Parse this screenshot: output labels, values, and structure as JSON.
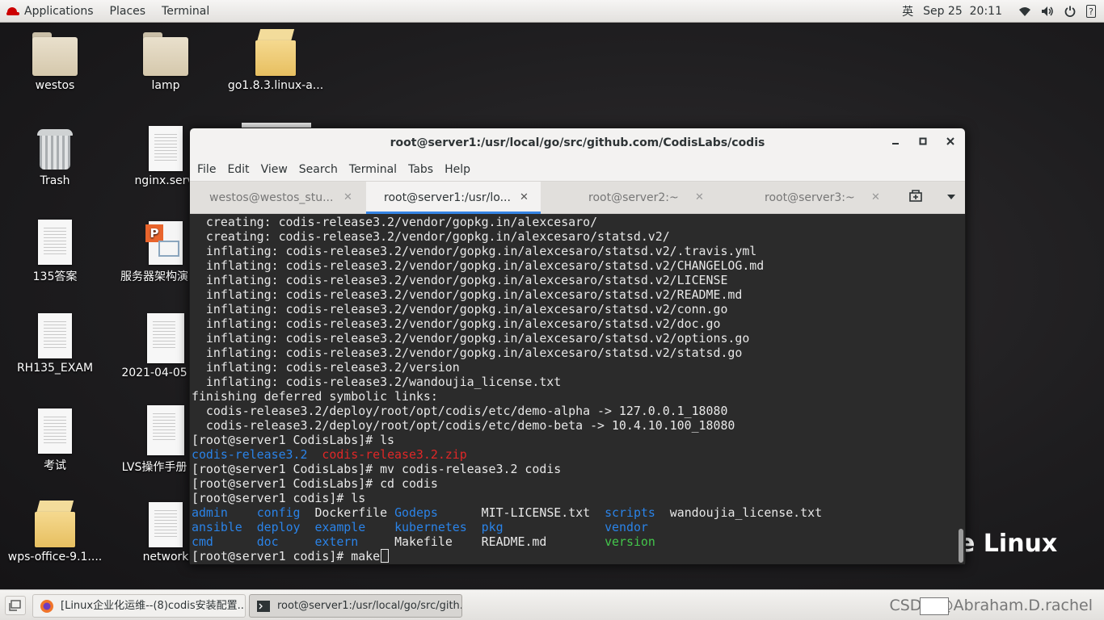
{
  "topbar": {
    "applications": "Applications",
    "places": "Places",
    "terminal": "Terminal",
    "input_method": "英",
    "clock": "Sep 25  20:11",
    "help": "?"
  },
  "desktop": {
    "icons": [
      {
        "label": "westos"
      },
      {
        "label": "lamp"
      },
      {
        "label": "go1.8.3.linux-a..."
      },
      {
        "label": "Trash"
      },
      {
        "label": "nginx.servi"
      },
      {
        "label": "135答案"
      },
      {
        "label": "服务器架构演"
      },
      {
        "label": "RH135_EXAM"
      },
      {
        "label": "2021-04-05"
      },
      {
        "label": "考试"
      },
      {
        "label": "LVS操作手册"
      },
      {
        "label": "wps-office-9.1...."
      },
      {
        "label": "network"
      }
    ],
    "background_logo_text": "e Linux"
  },
  "window": {
    "title": "root@server1:/usr/local/go/src/github.com/CodisLabs/codis",
    "menu": [
      "File",
      "Edit",
      "View",
      "Search",
      "Terminal",
      "Tabs",
      "Help"
    ],
    "tabs": [
      {
        "label": "westos@westos_stu..."
      },
      {
        "label": "root@server1:/usr/lo..."
      },
      {
        "label": "root@server2:~"
      },
      {
        "label": "root@server3:~"
      }
    ],
    "active_tab_index": 1
  },
  "terminal": {
    "lines": [
      "  creating: codis-release3.2/vendor/gopkg.in/alexcesaro/",
      "  creating: codis-release3.2/vendor/gopkg.in/alexcesaro/statsd.v2/",
      "  inflating: codis-release3.2/vendor/gopkg.in/alexcesaro/statsd.v2/.travis.yml",
      "  inflating: codis-release3.2/vendor/gopkg.in/alexcesaro/statsd.v2/CHANGELOG.md",
      "  inflating: codis-release3.2/vendor/gopkg.in/alexcesaro/statsd.v2/LICENSE",
      "  inflating: codis-release3.2/vendor/gopkg.in/alexcesaro/statsd.v2/README.md",
      "  inflating: codis-release3.2/vendor/gopkg.in/alexcesaro/statsd.v2/conn.go",
      "  inflating: codis-release3.2/vendor/gopkg.in/alexcesaro/statsd.v2/doc.go",
      "  inflating: codis-release3.2/vendor/gopkg.in/alexcesaro/statsd.v2/options.go",
      "  inflating: codis-release3.2/vendor/gopkg.in/alexcesaro/statsd.v2/statsd.go",
      "  inflating: codis-release3.2/version",
      "  inflating: codis-release3.2/wandoujia_license.txt",
      "finishing deferred symbolic links:",
      "  codis-release3.2/deploy/root/opt/codis/etc/demo-alpha -> 127.0.0.1_18080",
      "  codis-release3.2/deploy/root/opt/codis/etc/demo-beta -> 10.4.10.100_18080",
      "[root@server1 CodisLabs]# ls"
    ],
    "ls1": {
      "dir": "codis-release3.2",
      "zip": "codis-release3.2.zip"
    },
    "cmd_mv": "[root@server1 CodisLabs]# mv codis-release3.2 codis",
    "cmd_cd": "[root@server1 CodisLabs]# cd codis",
    "cmd_ls": "[root@server1 codis]# ls",
    "ls_rows": [
      [
        "admin",
        "config",
        "Dockerfile",
        "Godeps",
        "MIT-LICENSE.txt",
        "scripts",
        "wandoujia_license.txt"
      ],
      [
        "ansible",
        "deploy",
        "example",
        "kubernetes",
        "pkg",
        "vendor",
        ""
      ],
      [
        "cmd",
        "doc",
        "extern",
        "Makefile",
        "README.md",
        "version",
        ""
      ]
    ],
    "prompt": "[root@server1 codis]# ",
    "current_input": "make"
  },
  "taskbar": {
    "tasks": [
      {
        "label": "[Linux企业化运维--(8)codis安装配置..."
      },
      {
        "label": "root@server1:/usr/local/go/src/gith..."
      }
    ],
    "watermark": "CSDN @Abraham.D.rachel"
  },
  "colors": {
    "terminal_bg": "#2b2b2b",
    "dir_blue": "#2a83e8",
    "archive_red": "#e02727",
    "exec_green": "#43c64b",
    "tab_accent": "#3584e4"
  }
}
